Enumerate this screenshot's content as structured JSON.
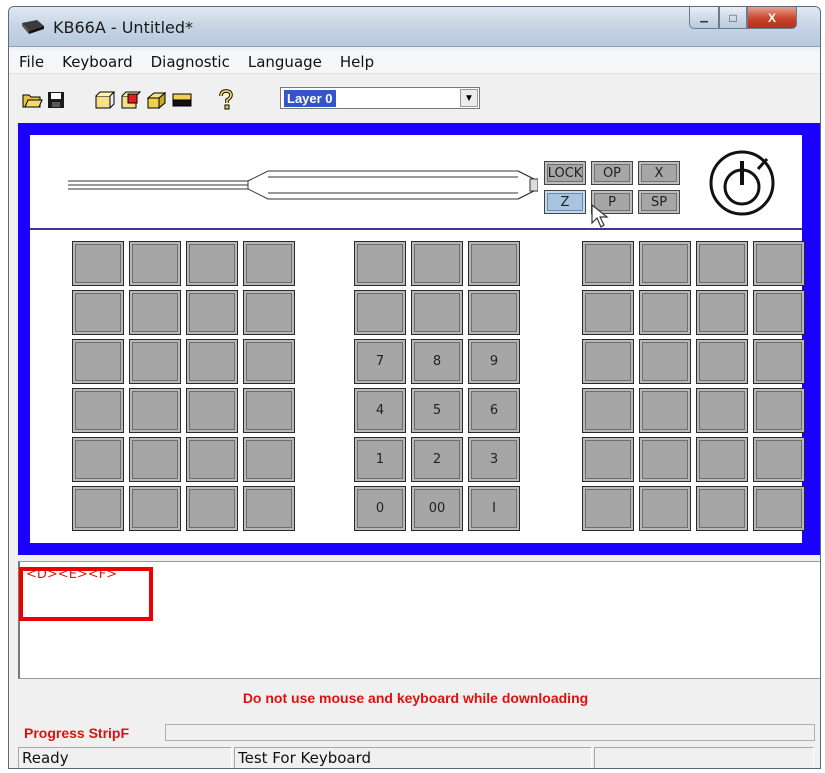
{
  "window": {
    "title": "KB66A - Untitled*",
    "minimize_glyph": "▁",
    "maximize_glyph": "□",
    "close_glyph": "X"
  },
  "menu": [
    {
      "label": "File"
    },
    {
      "label": "Keyboard"
    },
    {
      "label": "Diagnostic"
    },
    {
      "label": "Language"
    },
    {
      "label": "Help"
    }
  ],
  "toolbar": {
    "icons": [
      "open-folder-icon",
      "save-icon",
      "key-outline-icon",
      "key-edit-icon",
      "key-3d-icon",
      "key-flat-icon",
      "help-icon"
    ],
    "layer_select": {
      "value": "Layer 0",
      "arrow_glyph": "▼"
    }
  },
  "keyboard": {
    "function_keys": [
      "LOCK",
      "OP",
      "X",
      "Z",
      "P",
      "SP"
    ],
    "active_function_key": "Z",
    "numpad_labels": [
      "",
      "",
      "",
      "",
      "",
      "",
      "7",
      "8",
      "9",
      "4",
      "5",
      "6",
      "1",
      "2",
      "3",
      "0",
      "00",
      "I"
    ]
  },
  "output": {
    "text": "<D><E><F>"
  },
  "warning": "Do not use mouse and keyboard while downloading",
  "progress": {
    "label": "Progress StripF",
    "fraction": 0
  },
  "status": {
    "ready": "Ready",
    "mode": "Test For Keyboard",
    "pane3": "",
    "pane4": ""
  },
  "colors": {
    "frame": "#1a00ff",
    "key_gray": "#a6a6a6",
    "key_active": "#a9c4e0",
    "alert_red": "#e01010"
  }
}
